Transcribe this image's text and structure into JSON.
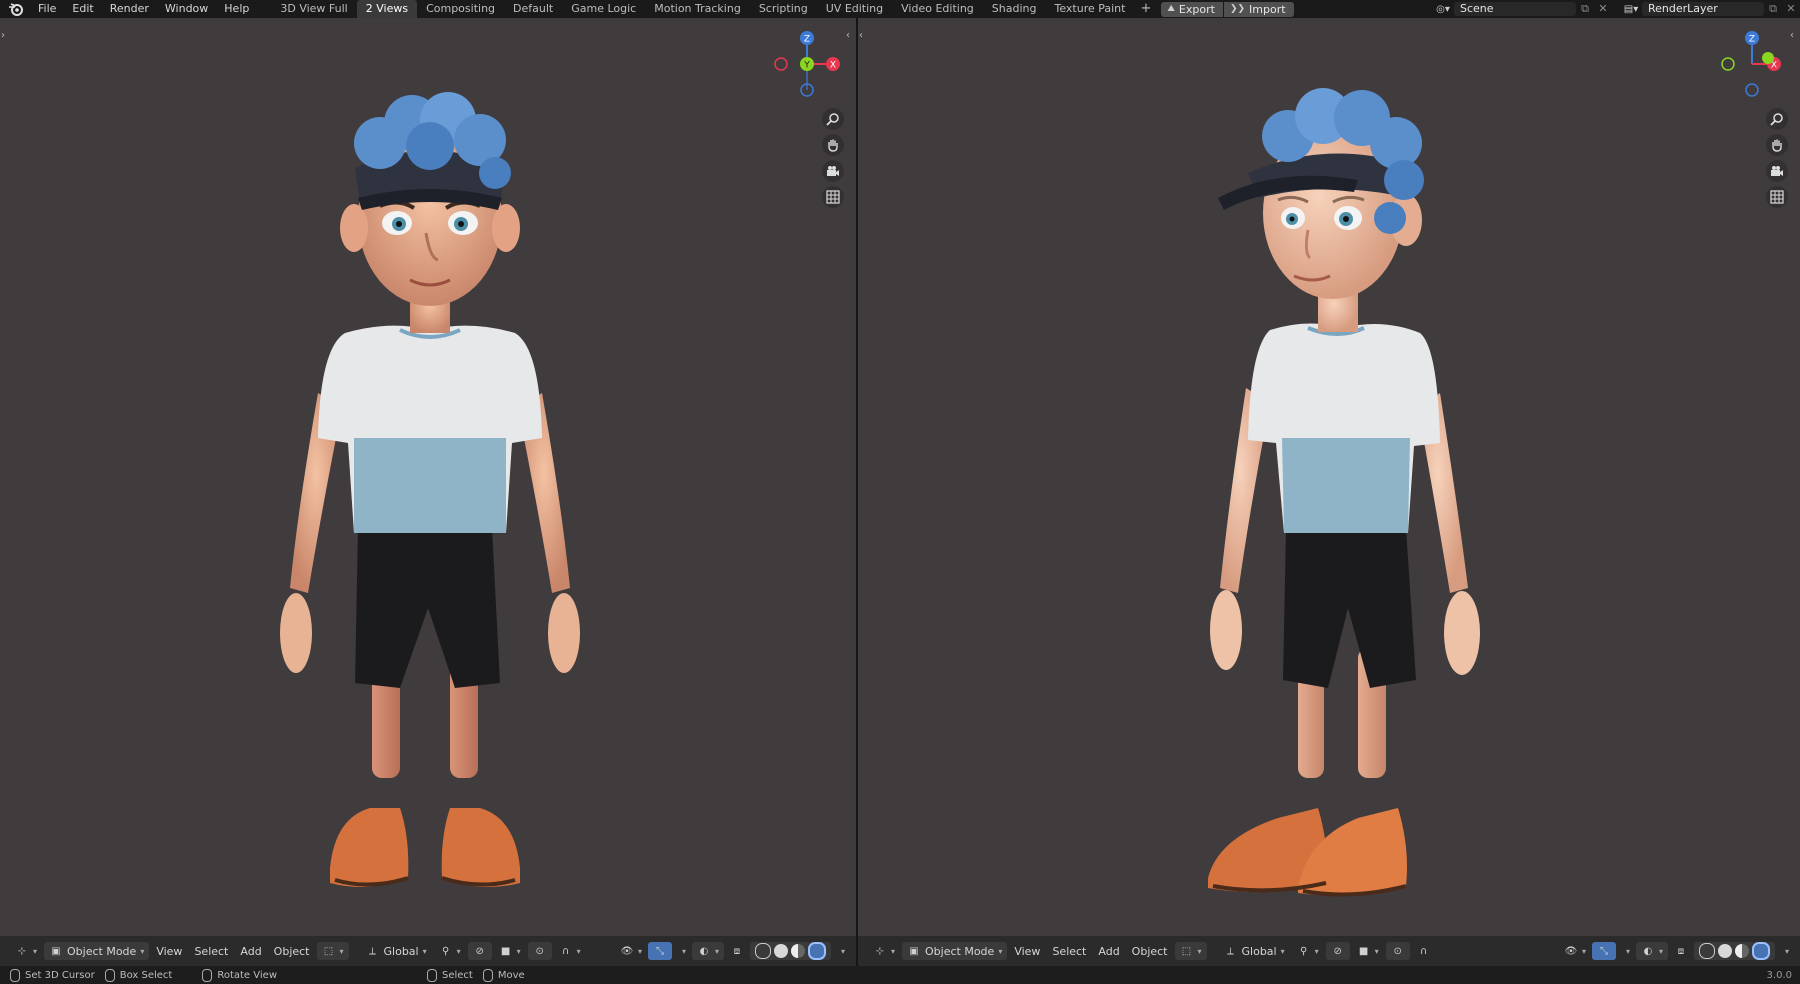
{
  "topbar": {
    "logo_icon": "blender-logo-icon",
    "menus": [
      "File",
      "Edit",
      "Render",
      "Window",
      "Help"
    ],
    "workspaces": [
      "3D View Full",
      "2 Views",
      "Compositing",
      "Default",
      "Game Logic",
      "Motion Tracking",
      "Scripting",
      "UV Editing",
      "Video Editing",
      "Shading",
      "Texture Paint"
    ],
    "active_workspace": "2 Views",
    "add_workspace": "+",
    "export_label": "Export",
    "import_label": "Import",
    "scene_name": "Scene",
    "view_layer_name": "RenderLayer"
  },
  "viewports": {
    "left": {
      "gizmo": {
        "z": "Z",
        "y": "Y",
        "x": "X"
      },
      "nav_tools": [
        "zoom-icon",
        "hand-pan-icon",
        "camera-icon",
        "grid-ortho-icon"
      ]
    },
    "right": {
      "gizmo": {
        "z": "Z",
        "x": "X"
      },
      "nav_tools": [
        "zoom-icon",
        "hand-pan-icon",
        "camera-icon",
        "grid-ortho-icon"
      ]
    }
  },
  "header": {
    "mode": "Object Mode",
    "menus": [
      "View",
      "Select",
      "Add",
      "Object"
    ],
    "transform_orientation": "Global"
  },
  "statusbar": {
    "items": [
      "Set 3D Cursor",
      "Box Select",
      "Rotate View",
      "Select",
      "Move"
    ],
    "version": "3.0.0"
  },
  "colors": {
    "viewport_bg": "#403b3d",
    "axis_x": "#e8384f",
    "axis_y": "#8bd420",
    "axis_z": "#3c7bd9",
    "active_blue": "#4772b3",
    "shirt_top": "#e6e8ea",
    "shirt_bottom": "#8fb4c8",
    "hair": "#5b8fcc",
    "shoes": "#d5713d"
  }
}
